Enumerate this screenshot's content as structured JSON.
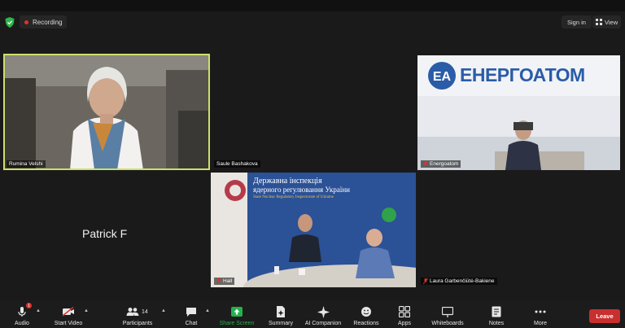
{
  "header": {
    "recording_label": "Recording",
    "sign_in_label": "Sign in",
    "view_label": "View"
  },
  "tiles": [
    {
      "name": "Rumina Velshi",
      "video": true,
      "active_speaker": true
    },
    {
      "name": "Saule Bashakova",
      "video": false
    },
    {
      "name": "Energoatom",
      "video": true,
      "muted": true,
      "banner_text": "ЕНЕРГОАТОМ"
    },
    {
      "name": "Patrick F",
      "video": false
    },
    {
      "name": "Hall",
      "video": true,
      "muted": true,
      "banner_lines": [
        "Державна інспекція",
        "ядерного регулювання України",
        "State Nuclear Regulatory Inspectorate of Ukraine"
      ]
    },
    {
      "name": "Laura Garbenčiūtė-Bakiene",
      "video": false,
      "muted": true
    }
  ],
  "toolbar": {
    "audio": "Audio",
    "audio_badge": "1",
    "start_video": "Start Video",
    "participants": "Participants",
    "participants_count": "14",
    "chat": "Chat",
    "share_screen": "Share Screen",
    "summary": "Summary",
    "ai_companion": "AI Companion",
    "reactions": "Reactions",
    "apps": "Apps",
    "whiteboards": "Whiteboards",
    "notes": "Notes",
    "more": "More",
    "leave": "Leave"
  },
  "colors": {
    "active_speaker_border": "#cde06a",
    "share_green": "#23b14d",
    "leave_red": "#c8302f",
    "recording_red": "#e0322b"
  }
}
